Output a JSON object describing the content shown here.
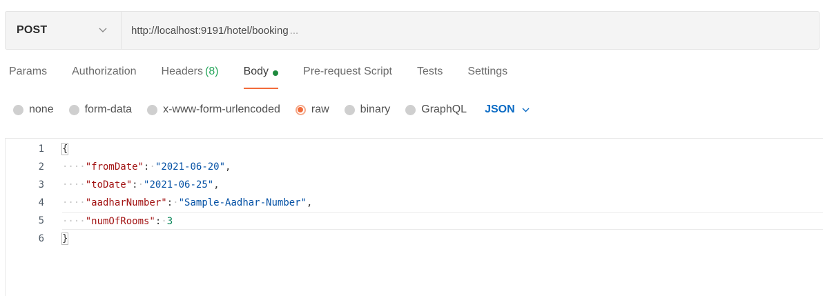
{
  "request": {
    "method": "POST",
    "url": "http://localhost:9191/hotel/booking",
    "url_overflow": "..."
  },
  "tabs": [
    {
      "label": "Params"
    },
    {
      "label": "Authorization"
    },
    {
      "label": "Headers",
      "count": "(8)"
    },
    {
      "label": "Body",
      "active": true
    },
    {
      "label": "Pre-request Script"
    },
    {
      "label": "Tests"
    },
    {
      "label": "Settings"
    }
  ],
  "body_types": [
    {
      "label": "none",
      "selected": false
    },
    {
      "label": "form-data",
      "selected": false
    },
    {
      "label": "x-www-form-urlencoded",
      "selected": false
    },
    {
      "label": "raw",
      "selected": true
    },
    {
      "label": "binary",
      "selected": false
    },
    {
      "label": "GraphQL",
      "selected": false
    }
  ],
  "raw_format": "JSON",
  "editor": {
    "line_numbers": [
      "1",
      "2",
      "3",
      "4",
      "5",
      "6"
    ],
    "open_brace": "{",
    "close_brace": "}",
    "indent": "····",
    "fields": [
      {
        "key": "\"fromDate\"",
        "colon": ":",
        "value": "\"2021-06-20\"",
        "type": "string",
        "comma": ","
      },
      {
        "key": "\"toDate\"",
        "colon": ":",
        "value": "\"2021-06-25\"",
        "type": "string",
        "comma": ","
      },
      {
        "key": "\"aadharNumber\"",
        "colon": ":",
        "value": "\"Sample-Aadhar-Number\"",
        "type": "string",
        "comma": ","
      },
      {
        "key": "\"numOfRooms\"",
        "colon": ":",
        "value": "3",
        "type": "number",
        "comma": ""
      }
    ]
  },
  "colors": {
    "accent": "#f26b3a",
    "body_dot": "#1f8a3e",
    "json_link": "#0b6bc4",
    "json_key": "#a31515",
    "json_string": "#0451a5",
    "json_number": "#098658"
  }
}
